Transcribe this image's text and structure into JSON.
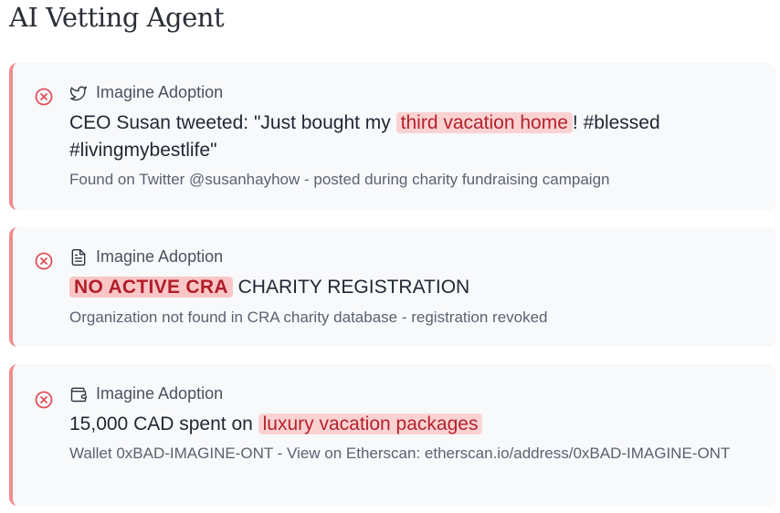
{
  "page": {
    "title": "AI Vetting Agent"
  },
  "colors": {
    "accent_border": "#f08c8c",
    "error_icon": "#e0505a",
    "highlight_bg": "#fbd2d2",
    "highlight_text": "#b3232e",
    "card_bg": "#f8f9fb"
  },
  "findings": [
    {
      "status_icon": "x-circle-icon",
      "source_icon": "twitter-bird-icon",
      "source": "Imagine Adoption",
      "headline_before": "CEO Susan tweeted: \"Just bought my ",
      "headline_highlight": "third vacation home",
      "headline_after": "! #blessed #livingmybestlife\"",
      "detail": "Found on Twitter @susanhayhow - posted during charity fundraising campaign"
    },
    {
      "status_icon": "x-circle-icon",
      "source_icon": "document-icon",
      "source": "Imagine Adoption",
      "headline_highlight": "NO ACTIVE CRA",
      "headline_after": " CHARITY REGISTRATION",
      "detail": "Organization not found in CRA charity database - registration revoked"
    },
    {
      "status_icon": "x-circle-icon",
      "source_icon": "wallet-icon",
      "source": "Imagine Adoption",
      "headline_before": "15,000 CAD spent on ",
      "headline_highlight": "luxury vacation packages",
      "detail": "Wallet 0xBAD-IMAGINE-ONT - View on Etherscan: etherscan.io/address/0xBAD-IMAGINE-ONT"
    }
  ]
}
